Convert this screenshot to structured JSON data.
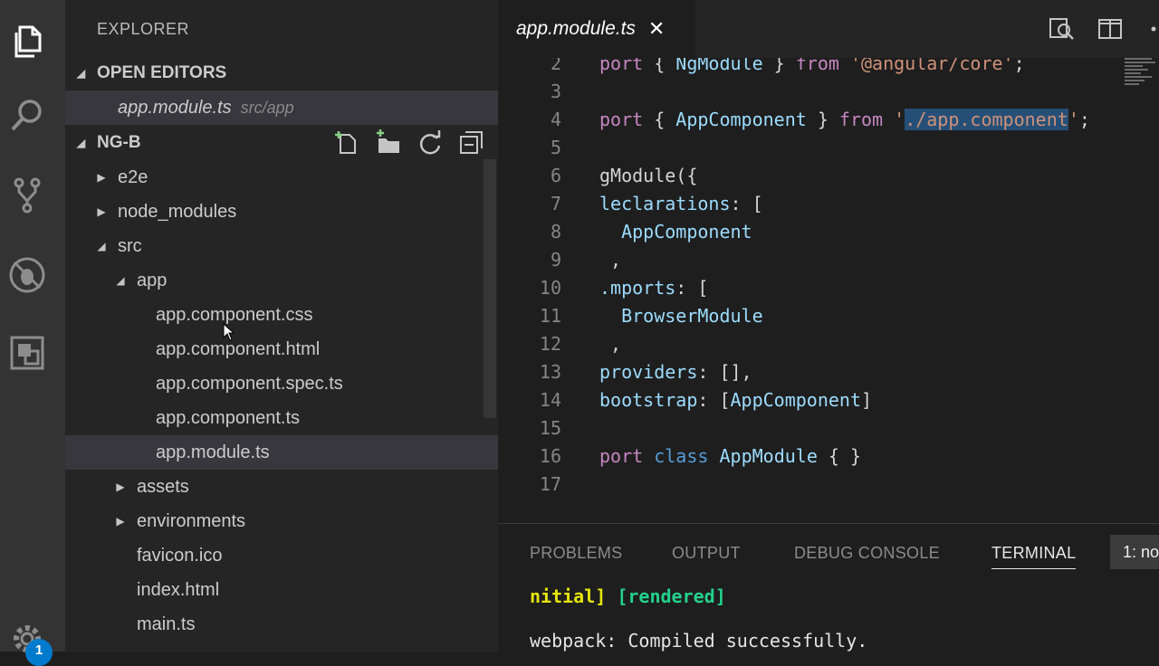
{
  "explorer": {
    "title": "EXPLORER",
    "open_editors": {
      "heading": "OPEN EDITORS",
      "item_name": "app.module.ts",
      "item_path": "src/app"
    },
    "project": {
      "heading": "NG-B",
      "tree": [
        {
          "label": "e2e",
          "type": "folder",
          "expanded": false
        },
        {
          "label": "node_modules",
          "type": "folder",
          "expanded": false
        },
        {
          "label": "src",
          "type": "folder",
          "expanded": true
        },
        {
          "label": "app",
          "type": "folder",
          "expanded": true
        },
        {
          "label": "app.component.css",
          "type": "file"
        },
        {
          "label": "app.component.html",
          "type": "file"
        },
        {
          "label": "app.component.spec.ts",
          "type": "file"
        },
        {
          "label": "app.component.ts",
          "type": "file"
        },
        {
          "label": "app.module.ts",
          "type": "file",
          "selected": true
        },
        {
          "label": "assets",
          "type": "folder",
          "expanded": false
        },
        {
          "label": "environments",
          "type": "folder",
          "expanded": false
        },
        {
          "label": "favicon.ico",
          "type": "file"
        },
        {
          "label": "index.html",
          "type": "file"
        },
        {
          "label": "main.ts",
          "type": "file"
        }
      ]
    }
  },
  "editor": {
    "tab_label": "app.module.ts",
    "tab_close": "✕",
    "lines": [
      {
        "n": "2",
        "parts": [
          [
            "kw",
            "port"
          ],
          [
            "",
            " { "
          ],
          [
            "ident",
            "NgModule"
          ],
          [
            "",
            " } "
          ],
          [
            "kw",
            "from"
          ],
          [
            "",
            " "
          ],
          [
            "str",
            "'@angular/core'"
          ],
          [
            "",
            ";"
          ]
        ]
      },
      {
        "n": "3",
        "parts": []
      },
      {
        "n": "4",
        "parts": [
          [
            "kw",
            "port"
          ],
          [
            "",
            " { "
          ],
          [
            "ident",
            "AppComponent"
          ],
          [
            "",
            " } "
          ],
          [
            "kw",
            "from"
          ],
          [
            "",
            " "
          ],
          [
            "str",
            "'"
          ],
          [
            "strhl",
            "./app.component"
          ],
          [
            "str",
            "'"
          ],
          [
            "",
            ";"
          ]
        ]
      },
      {
        "n": "5",
        "parts": []
      },
      {
        "n": "6",
        "parts": [
          [
            "",
            "gModule({"
          ]
        ]
      },
      {
        "n": "7",
        "parts": [
          [
            "ident",
            "leclarations"
          ],
          [
            "",
            ": ["
          ]
        ]
      },
      {
        "n": "8",
        "parts": [
          [
            "",
            "  "
          ],
          [
            "ident",
            "AppComponent"
          ]
        ]
      },
      {
        "n": "9",
        "parts": [
          [
            "",
            " ,"
          ]
        ]
      },
      {
        "n": "10",
        "parts": [
          [
            "ident",
            ".mports"
          ],
          [
            "",
            ": ["
          ]
        ]
      },
      {
        "n": "11",
        "parts": [
          [
            "",
            "  "
          ],
          [
            "ident",
            "BrowserModule"
          ]
        ]
      },
      {
        "n": "12",
        "parts": [
          [
            "",
            " ,"
          ]
        ]
      },
      {
        "n": "13",
        "parts": [
          [
            "ident",
            "providers"
          ],
          [
            "",
            ": [],"
          ]
        ]
      },
      {
        "n": "14",
        "parts": [
          [
            "ident",
            "bootstrap"
          ],
          [
            "",
            ": ["
          ],
          [
            "ident",
            "AppComponent"
          ],
          [
            "",
            "]"
          ]
        ]
      },
      {
        "n": "15",
        "parts": []
      },
      {
        "n": "16",
        "parts": [
          [
            "kw",
            "port"
          ],
          [
            "",
            " "
          ],
          [
            "kw2",
            "class"
          ],
          [
            "",
            " "
          ],
          [
            "ident",
            "AppModule"
          ],
          [
            "",
            " { }"
          ]
        ]
      },
      {
        "n": "17",
        "parts": []
      }
    ]
  },
  "panel": {
    "tabs": [
      "PROBLEMS",
      "OUTPUT",
      "DEBUG CONSOLE",
      "TERMINAL"
    ],
    "active_tab": "TERMINAL",
    "terminal_select": "1: no",
    "line1_a": "nitial]",
    "line1_b": "[rendered]",
    "line2": "webpack: Compiled successfully."
  },
  "activity": {
    "icons": [
      "files-icon",
      "search-icon",
      "source-control-icon",
      "debug-icon",
      "extensions-icon",
      "gear-icon"
    ],
    "badge": "1"
  }
}
